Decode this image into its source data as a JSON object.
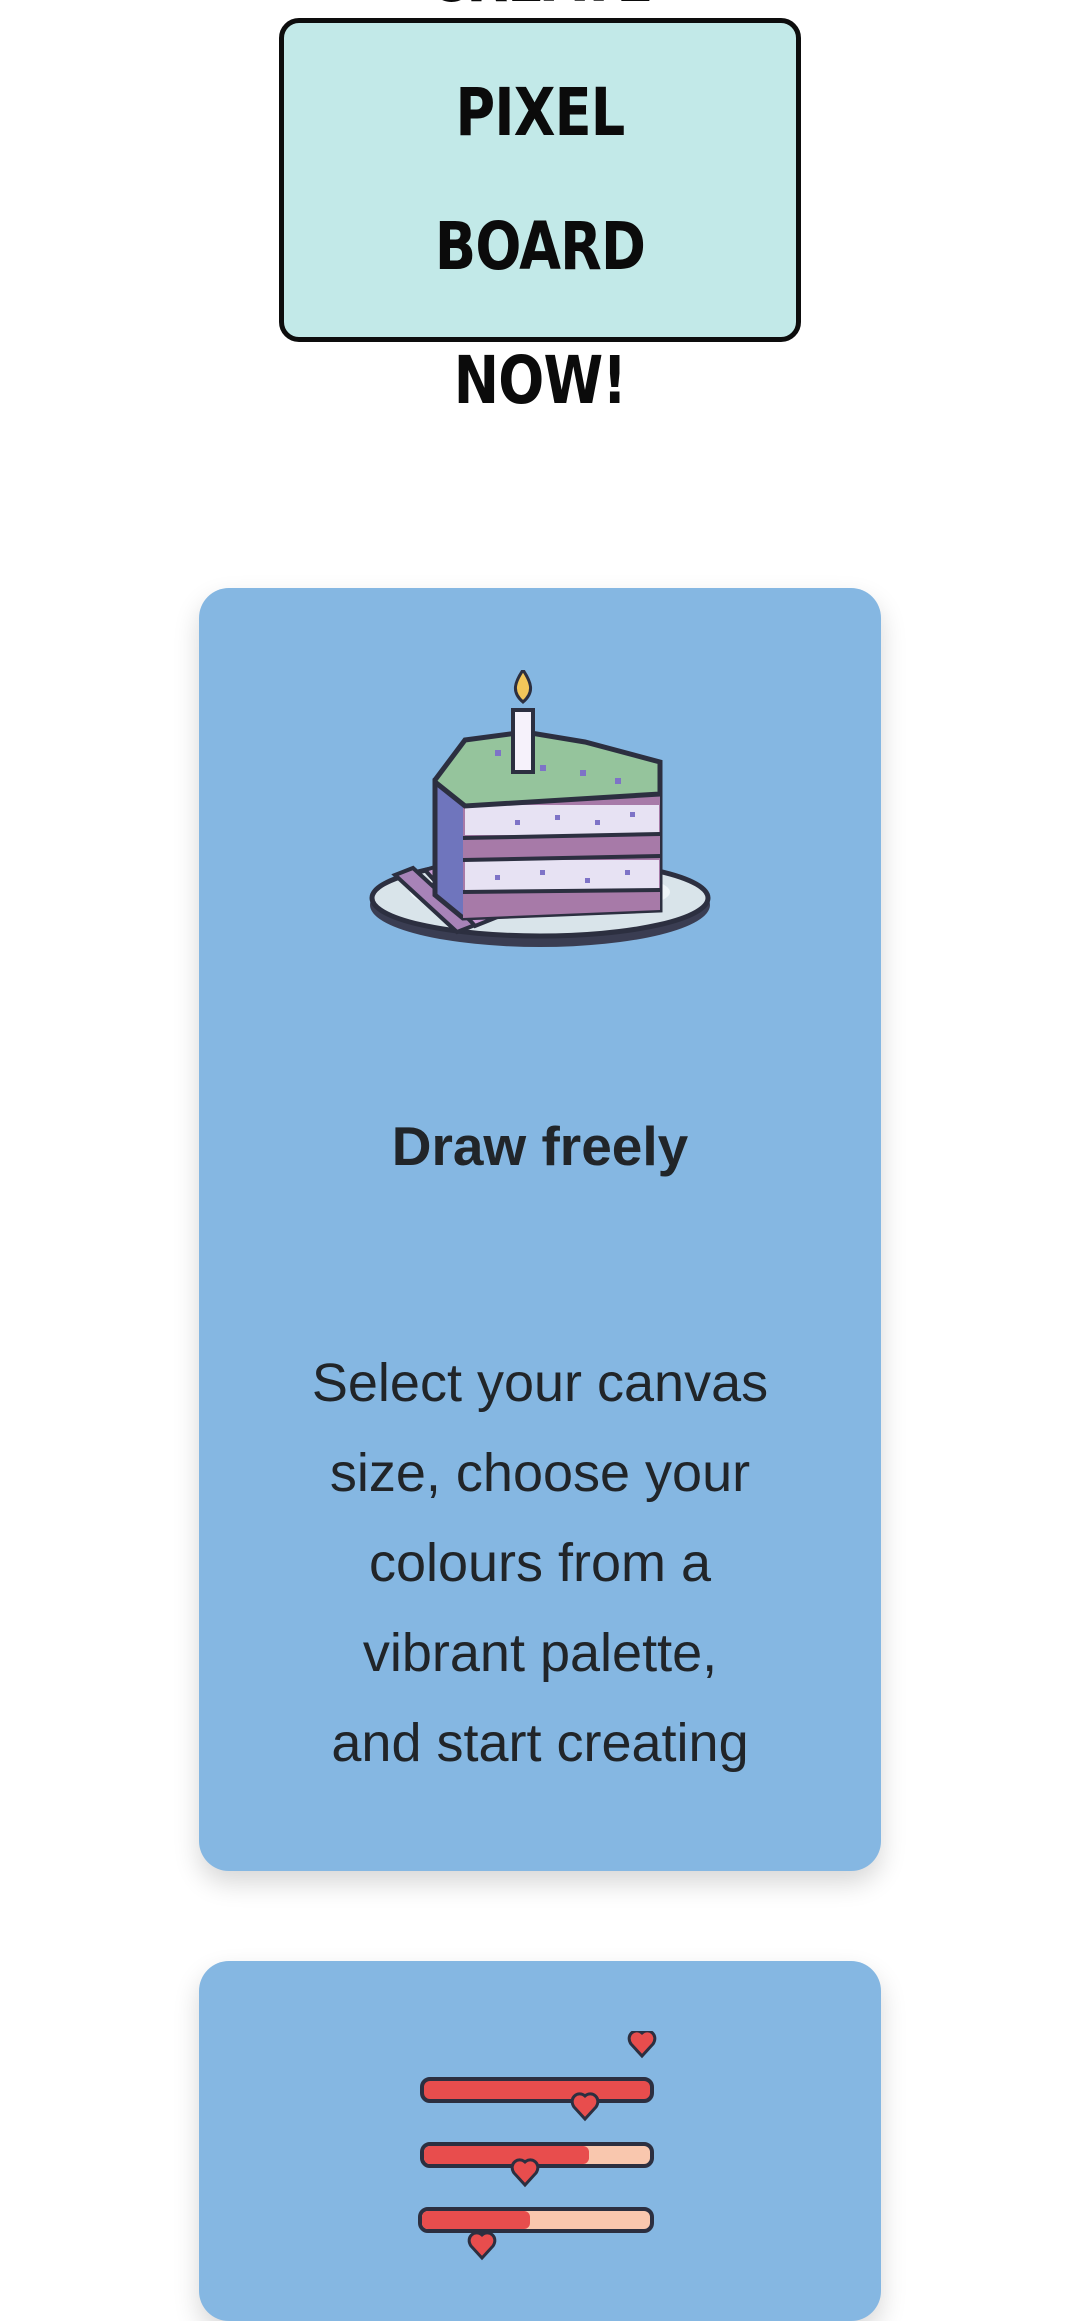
{
  "cta": {
    "label": "CREATE PIXEL\nBOARD NOW!"
  },
  "features": [
    {
      "icon": "pixel-cake-icon",
      "title": "Draw freely",
      "text": "Select your canvas\nsize, choose your\ncolours from a\nvibrant palette,\nand start creating"
    },
    {
      "icon": "health-bars-icon"
    }
  ],
  "colors": {
    "cta_background": "#c2e9e8",
    "cta_border": "#0d0d0d",
    "card_background": "#85b7e2",
    "text": "#212529",
    "bar_fill": "#e84d4d",
    "bar_empty": "#f9c7ae"
  }
}
